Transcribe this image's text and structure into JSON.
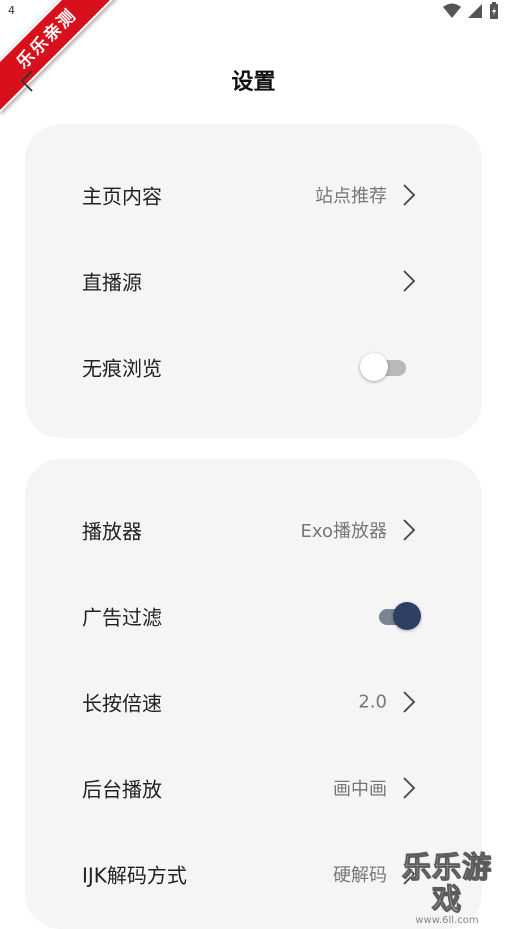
{
  "status_bar": {
    "time": "4",
    "icons": [
      "wifi-icon",
      "cell-signal-icon",
      "battery-charging-icon"
    ]
  },
  "ribbon": {
    "text": "乐乐亲测"
  },
  "header": {
    "title": "设置"
  },
  "group1": [
    {
      "label": "主页内容",
      "value": "站点推荐",
      "control": "chevron"
    },
    {
      "label": "直播源",
      "value": "",
      "control": "chevron"
    },
    {
      "label": "无痕浏览",
      "control": "toggle",
      "state": "off"
    }
  ],
  "group2": [
    {
      "label": "播放器",
      "value": "Exo播放器",
      "control": "chevron"
    },
    {
      "label": "广告过滤",
      "control": "toggle",
      "state": "on"
    },
    {
      "label": "长按倍速",
      "value": "2.0",
      "control": "chevron"
    },
    {
      "label": "后台播放",
      "value": "画中画",
      "control": "chevron"
    },
    {
      "label": "IJK解码方式",
      "value": "硬解码",
      "control": "chevron"
    }
  ],
  "watermark": {
    "title": "乐乐游戏",
    "url": "www.6ll.com"
  },
  "colors": {
    "accent": "#2e3f63",
    "card_bg": "#f5f5f6",
    "ribbon": "#d8101c"
  }
}
